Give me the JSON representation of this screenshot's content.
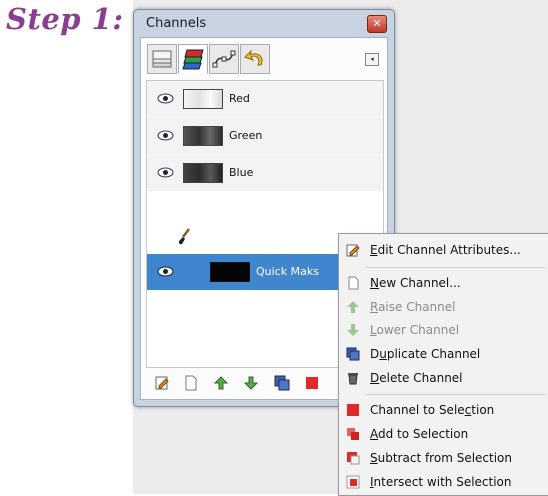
{
  "step_label": "Step 1:",
  "window": {
    "title": "Channels",
    "close_glyph": "✕"
  },
  "tabs": [
    {
      "icon": "layers-tab-icon"
    },
    {
      "icon": "channels-tab-icon"
    },
    {
      "icon": "paths-tab-icon"
    },
    {
      "icon": "undo-history-tab-icon"
    }
  ],
  "tab_menu_glyph": "◂",
  "channels": [
    {
      "label": "Red",
      "visible": true
    },
    {
      "label": "Green",
      "visible": true
    },
    {
      "label": "Blue",
      "visible": true
    }
  ],
  "quick_mask": {
    "label": "Quick Maks",
    "visible": true,
    "selected": true
  },
  "toolbar": [
    "edit-channel-icon",
    "new-channel-icon",
    "raise-channel-icon",
    "lower-channel-icon",
    "duplicate-channel-icon",
    "delete-channel-icon"
  ],
  "context_menu": {
    "items": [
      {
        "pre": "",
        "key": "E",
        "post": "dit Channel Attributes...",
        "disabled": false,
        "icon": "edit-icon"
      },
      {
        "pre": "",
        "key": "N",
        "post": "ew Channel...",
        "disabled": false,
        "icon": "new-channel-icon"
      },
      {
        "pre": "",
        "key": "R",
        "post": "aise Channel",
        "disabled": true,
        "icon": "raise-arrow-icon"
      },
      {
        "pre": "",
        "key": "L",
        "post": "ower Channel",
        "disabled": true,
        "icon": "lower-arrow-icon"
      },
      {
        "pre": "D",
        "key": "u",
        "post": "plicate Channel",
        "disabled": false,
        "icon": "duplicate-icon"
      },
      {
        "pre": "",
        "key": "D",
        "post": "elete Channel",
        "disabled": false,
        "icon": "trash-icon"
      },
      {
        "pre": "Channel to Sele",
        "key": "c",
        "post": "tion",
        "disabled": false,
        "icon": "channel-to-selection-icon"
      },
      {
        "pre": "",
        "key": "A",
        "post": "dd to Selection",
        "disabled": false,
        "icon": "add-selection-icon"
      },
      {
        "pre": "",
        "key": "S",
        "post": "ubtract from Selection",
        "disabled": false,
        "icon": "subtract-selection-icon"
      },
      {
        "pre": "",
        "key": "I",
        "post": "ntersect with Selection",
        "disabled": false,
        "icon": "intersect-selection-icon"
      }
    ]
  },
  "colors": {
    "selection": "#3f86cf",
    "step_label": "#8b3d8f",
    "close_button": "#c0392b"
  }
}
